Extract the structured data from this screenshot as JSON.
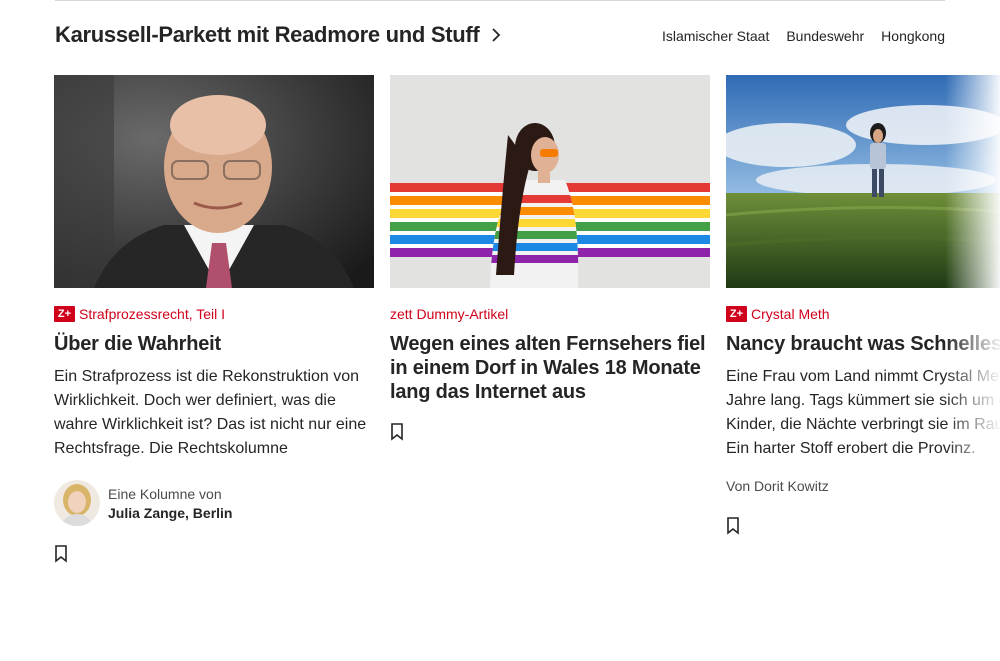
{
  "section": {
    "title": "Karussell-Parkett mit Readmore und Stuff",
    "tags": [
      "Islamischer Staat",
      "Bundeswehr",
      "Hongkong"
    ]
  },
  "cards": [
    {
      "premium_badge": "Z+",
      "kicker": "Strafprozessrecht, Teil I",
      "headline": "Über die Wahrheit",
      "teaser_lines": [
        "Ein Strafprozess ist die Rekonstruktion von",
        "Wirklichkeit. Doch wer definiert, was die",
        "wahre Wirklichkeit ist? Das ist nicht nur eine",
        "Rechtsfrage. Die Rechtskolumne"
      ],
      "author_prefix": "Eine Kolumne von",
      "author_name": "Julia Zange, Berlin"
    },
    {
      "kicker": "zett Dummy-Artikel",
      "headline_lines": [
        "Wegen eines alten Fernsehers fiel",
        "in einem Dorf in Wales 18 Monate",
        "lang das Internet aus"
      ]
    },
    {
      "premium_badge": "Z+",
      "kicker": "Crystal Meth",
      "headline": "Nancy braucht was Schnelles",
      "teaser_lines": [
        "Eine Frau vom Land nimmt Crystal Meth",
        "Jahre lang. Tags kümmert sie sich um d",
        "Kinder, die Nächte verbringt sie im Rau",
        "Ein harter Stoff erobert die Provinz."
      ],
      "byline": "Von Dorit Kowitz"
    }
  ],
  "icons": {
    "chevron": "chevron-right-icon",
    "bookmark": "bookmark-icon",
    "premium": "zplus-badge"
  },
  "colors": {
    "accent": "#d0021b",
    "text": "#252525",
    "muted": "#4b4b4b"
  }
}
